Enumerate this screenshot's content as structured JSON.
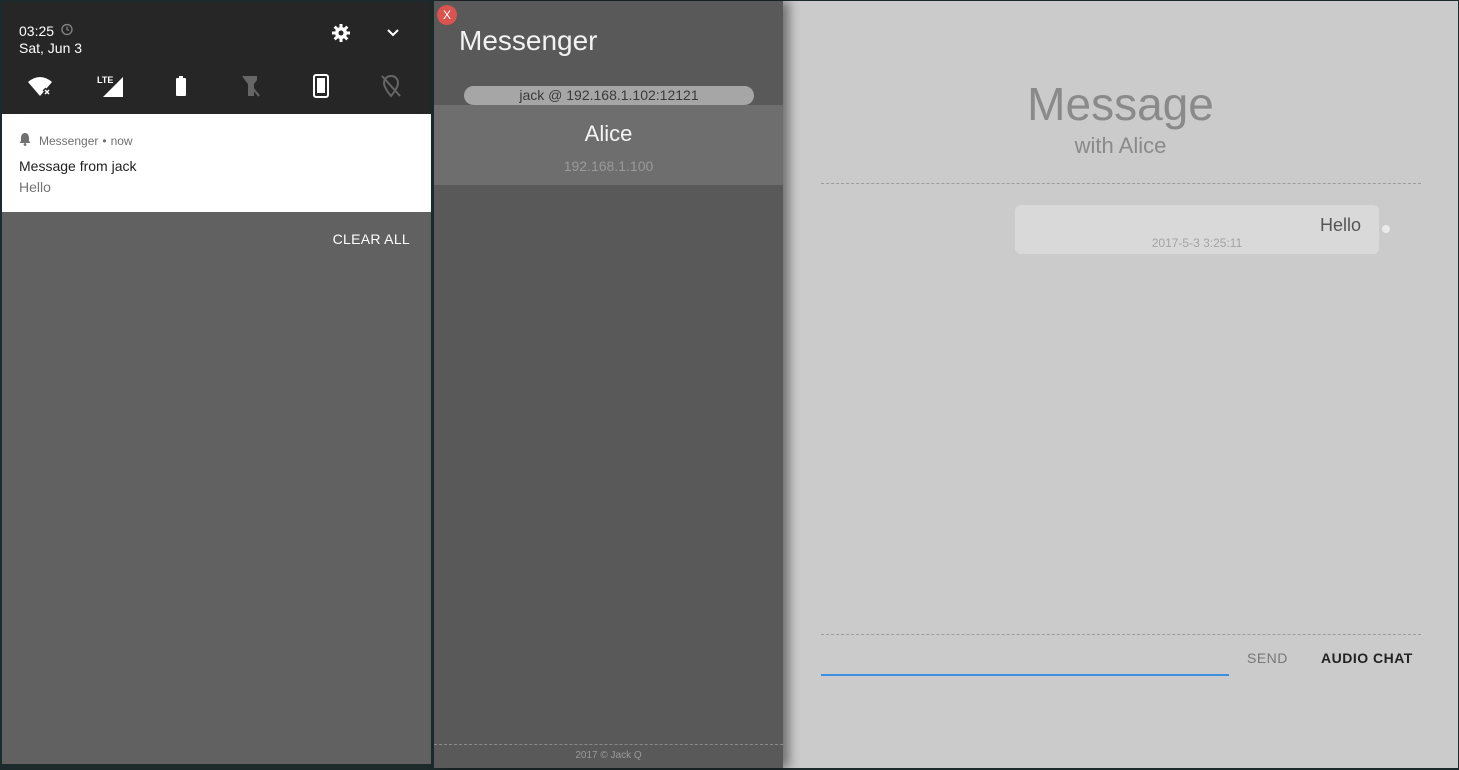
{
  "android": {
    "time": "03:25",
    "date": "Sat, Jun 3",
    "quick_settings": [
      "wifi-off-icon",
      "lte-signal-icon",
      "battery-icon",
      "flashlight-off-icon",
      "rotation-icon",
      "location-off-icon"
    ],
    "notification": {
      "app": "Messenger",
      "when": "now",
      "separator": "•",
      "title": "Message from jack",
      "body": "Hello"
    },
    "clear_all": "CLEAR ALL"
  },
  "messenger": {
    "close_label": "X",
    "app_title": "Messenger",
    "host": "jack @ 192.168.1.102:12121",
    "contacts": [
      {
        "name": "Alice",
        "ip": "192.168.1.100"
      }
    ],
    "footer": "2017 © Jack Q"
  },
  "chat": {
    "title": "Message",
    "subtitle": "with Alice",
    "messages": [
      {
        "text": "Hello",
        "time": "2017-5-3 3:25:11"
      }
    ],
    "input_value": "",
    "send_label": "SEND",
    "audio_label": "AUDIO CHAT"
  },
  "colors": {
    "accent": "#3d8fe0",
    "close": "#d9534f",
    "sidebar": "#595959",
    "chat_bg": "#cbcbcb"
  }
}
